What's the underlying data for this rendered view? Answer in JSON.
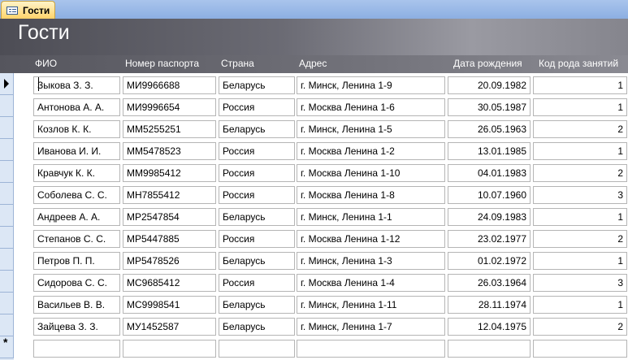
{
  "tab": {
    "label": "Гости",
    "icon": "form-icon"
  },
  "form": {
    "title": "Гости"
  },
  "columns": {
    "fio": "ФИО",
    "passport": "Номер паспорта",
    "country": "Страна",
    "address": "Адрес",
    "birthdate": "Дата рождения",
    "occupation": "Код рода занятий"
  },
  "rows": [
    {
      "fio": "Зыкова З. З.",
      "passport": "МИ9966688",
      "country": "Беларусь",
      "address": "г. Минск, Ленина 1-9",
      "birthdate": "20.09.1982",
      "occupation": "1"
    },
    {
      "fio": "Антонова А. А.",
      "passport": "МИ9996654",
      "country": "Россия",
      "address": "г. Москва Ленина 1-6",
      "birthdate": "30.05.1987",
      "occupation": "1"
    },
    {
      "fio": "Козлов К. К.",
      "passport": "ММ5255251",
      "country": "Беларусь",
      "address": "г. Минск, Ленина 1-5",
      "birthdate": "26.05.1963",
      "occupation": "2"
    },
    {
      "fio": "Иванова И. И.",
      "passport": "ММ5478523",
      "country": "Россия",
      "address": "г. Москва Ленина 1-2",
      "birthdate": "13.01.1985",
      "occupation": "1"
    },
    {
      "fio": "Кравчук К. К.",
      "passport": "ММ9985412",
      "country": "Россия",
      "address": "г. Москва Ленина 1-10",
      "birthdate": "04.01.1983",
      "occupation": "2"
    },
    {
      "fio": "Соболева С. С.",
      "passport": "МН7855412",
      "country": "Россия",
      "address": "г. Москва Ленина 1-8",
      "birthdate": "10.07.1960",
      "occupation": "3"
    },
    {
      "fio": "Андреев А. А.",
      "passport": "МР2547854",
      "country": "Беларусь",
      "address": "г. Минск, Ленина 1-1",
      "birthdate": "24.09.1983",
      "occupation": "1"
    },
    {
      "fio": "Степанов С. С.",
      "passport": "МР5447885",
      "country": "Россия",
      "address": "г. Москва Ленина 1-12",
      "birthdate": "23.02.1977",
      "occupation": "2"
    },
    {
      "fio": "Петров П. П.",
      "passport": "МР5478526",
      "country": "Беларусь",
      "address": "г. Минск, Ленина 1-3",
      "birthdate": "01.02.1972",
      "occupation": "1"
    },
    {
      "fio": "Сидорова С. С.",
      "passport": "МС9685412",
      "country": "Россия",
      "address": "г. Москва Ленина 1-4",
      "birthdate": "26.03.1964",
      "occupation": "3"
    },
    {
      "fio": "Васильев В. В.",
      "passport": "МС9998541",
      "country": "Беларусь",
      "address": "г. Минск, Ленина 1-11",
      "birthdate": "28.11.1974",
      "occupation": "1"
    },
    {
      "fio": "Зайцева З. З.",
      "passport": "МУ1452587",
      "country": "Беларусь",
      "address": "г. Минск, Ленина 1-7",
      "birthdate": "12.04.1975",
      "occupation": "2"
    }
  ],
  "new_record_symbol": "*"
}
